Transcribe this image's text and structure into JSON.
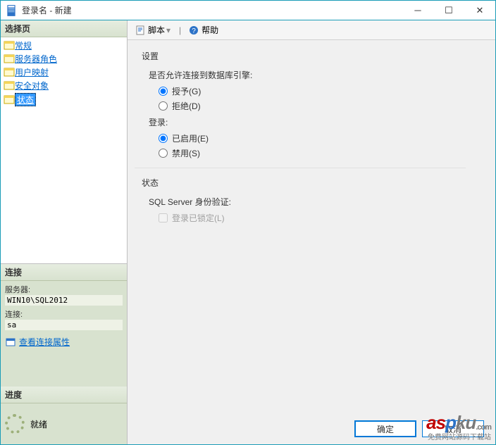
{
  "titlebar": {
    "title": "登录名 - 新建"
  },
  "sidebar": {
    "select_page_header": "选择页",
    "pages": [
      {
        "label": "常规"
      },
      {
        "label": "服务器角色"
      },
      {
        "label": "用户映射"
      },
      {
        "label": "安全对象"
      },
      {
        "label": "状态"
      }
    ],
    "connection_header": "连接",
    "server_label": "服务器:",
    "server_value": "WIN10\\SQL2012",
    "conn_label": "连接:",
    "conn_value": "sa",
    "view_props_link": "查看连接属性",
    "progress_header": "进度",
    "progress_status": "就绪"
  },
  "toolbar": {
    "script_label": "脚本",
    "help_label": "帮助"
  },
  "content": {
    "settings_header": "设置",
    "perm_label": "是否允许连接到数据库引擎:",
    "perm_grant": "授予(G)",
    "perm_deny": "拒绝(D)",
    "login_label": "登录:",
    "login_enabled": "已启用(E)",
    "login_disabled": "禁用(S)",
    "status_header": "状态",
    "sqlauth_label": "SQL Server 身份验证:",
    "locked_checkbox": "登录已锁定(L)"
  },
  "buttons": {
    "ok": "确定",
    "cancel": "取消"
  },
  "watermark": {
    "domain": ".com",
    "tagline": "免费网站源码下载站"
  }
}
